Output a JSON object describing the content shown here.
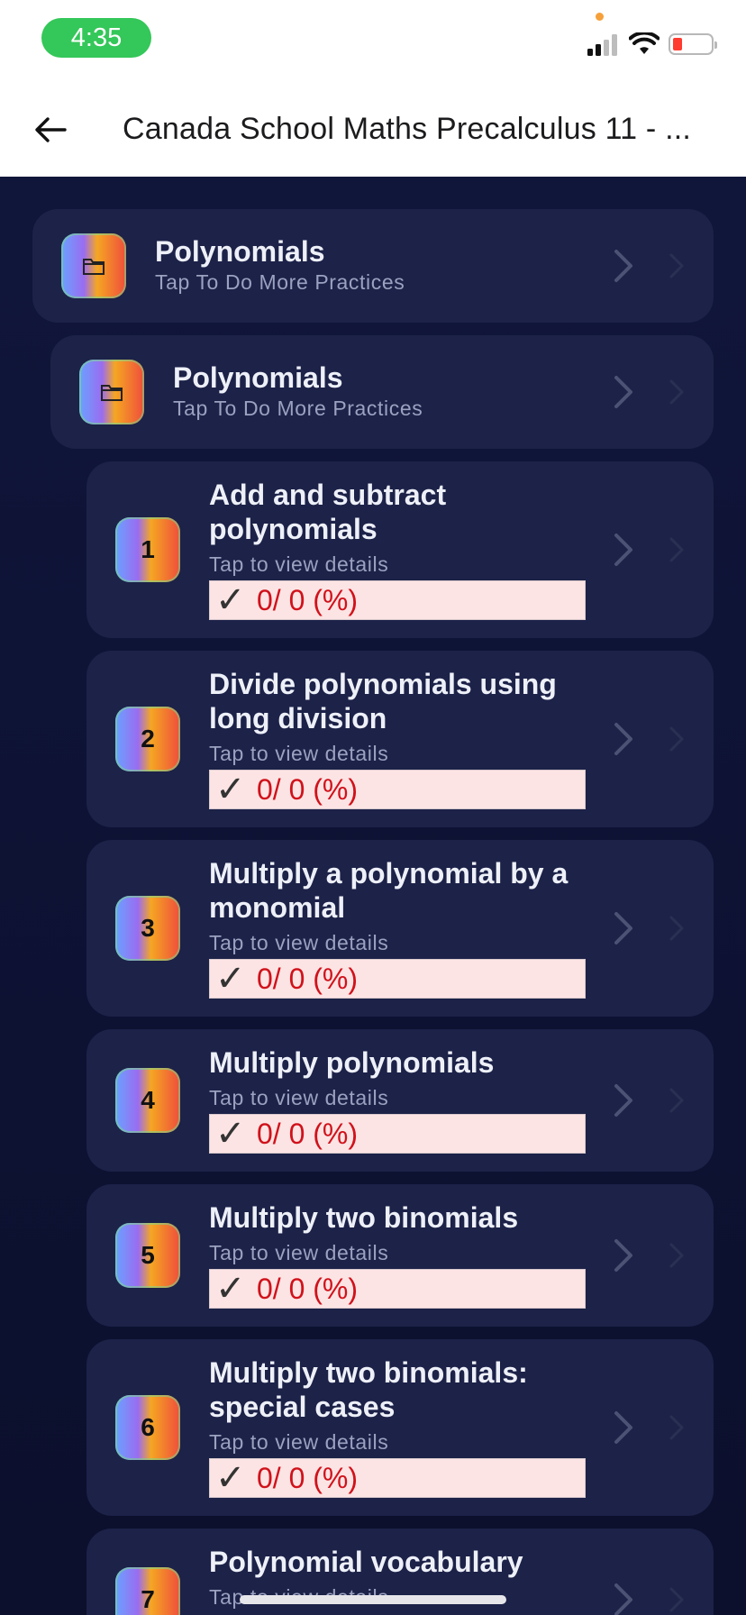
{
  "status": {
    "time": "4:35",
    "colors": {
      "pill": "#34c759",
      "battery_low": "#ff3b30",
      "dot": "#f5a03a"
    }
  },
  "nav": {
    "title": "Canada School Maths Precalculus 11 - ...",
    "back_icon": "arrow-left-icon"
  },
  "folders": [
    {
      "title": "Polynomials",
      "subtitle": "Tap To Do More Practices",
      "icon": "folder-icon"
    },
    {
      "title": "Polynomials",
      "subtitle": "Tap To Do More Practices",
      "icon": "folder-icon"
    }
  ],
  "topics": [
    {
      "number": "1",
      "title_line1": "Add and subtract",
      "title_line2": "polynomials",
      "subtitle": "Tap to view details",
      "progress": "0/ 0 (%)"
    },
    {
      "number": "2",
      "title_line1": "Divide polynomials using",
      "title_line2": "long division",
      "subtitle": "Tap to view details",
      "progress": "0/ 0 (%)"
    },
    {
      "number": "3",
      "title_line1": "Multiply a polynomial by a",
      "title_line2": "monomial",
      "subtitle": "Tap to view details",
      "progress": "0/ 0 (%)"
    },
    {
      "number": "4",
      "title_line1": "Multiply polynomials",
      "title_line2": "",
      "subtitle": "Tap to view details",
      "progress": "0/ 0 (%)"
    },
    {
      "number": "5",
      "title_line1": "Multiply two binomials",
      "title_line2": "",
      "subtitle": "Tap to view details",
      "progress": "0/ 0 (%)"
    },
    {
      "number": "6",
      "title_line1": "Multiply two binomials:",
      "title_line2": "special cases",
      "subtitle": "Tap to view details",
      "progress": "0/ 0 (%)"
    },
    {
      "number": "7",
      "title_line1": "Polynomial vocabulary",
      "title_line2": "",
      "subtitle": "Tap to view details",
      "progress": ""
    }
  ],
  "check_glyph": "✓",
  "theme": {
    "card": "#1c2248",
    "background": "#10163a",
    "progress_bg": "#fde4e4",
    "progress_text": "#d0121b"
  }
}
